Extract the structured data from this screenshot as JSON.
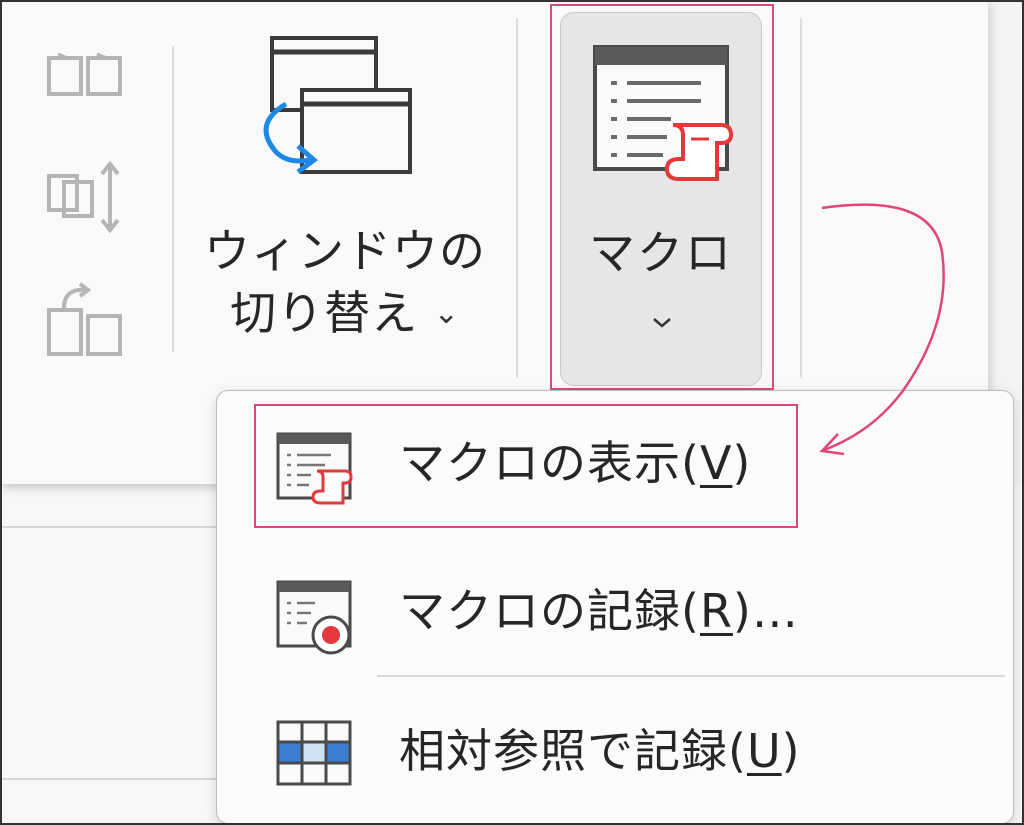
{
  "ribbon": {
    "switch_window": {
      "line1": "ウィンドウの",
      "line2": "切り替え",
      "chevron": "⌄"
    },
    "macro_button": {
      "label": "マクロ",
      "chevron": "⌄"
    },
    "small_buttons": [
      "side-by-side-icon",
      "sync-scroll-icon",
      "reset-window-position-icon"
    ]
  },
  "menu": {
    "items": [
      {
        "before": "マクロの表示(",
        "key": "V",
        "after": ")",
        "icon": "view-macros-icon"
      },
      {
        "before": "マクロの記録(",
        "key": "R",
        "after": ")…",
        "icon": "record-macro-icon"
      },
      {
        "before": "相対参照で記録(",
        "key": "U",
        "after": ")",
        "icon": "relative-reference-icon"
      }
    ]
  },
  "colors": {
    "highlight": "#e0457b",
    "macro_scroll_icon": "#e5383b",
    "relative_ref_blue": "#3b7fd4",
    "window_arrow_blue": "#1e88e5"
  }
}
